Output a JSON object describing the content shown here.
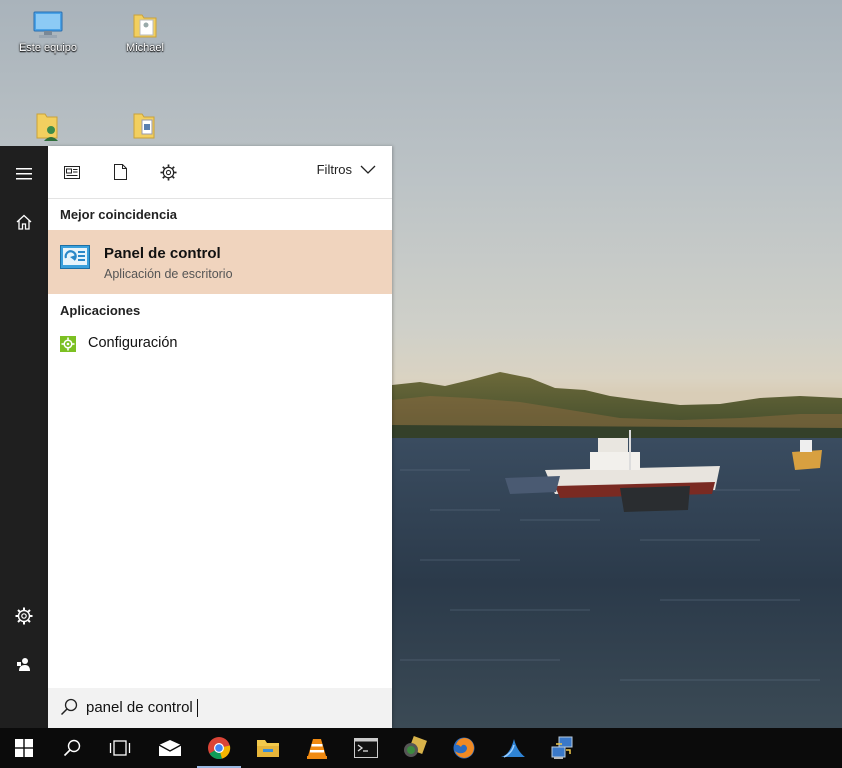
{
  "desktop": {
    "icons": [
      {
        "label": "Este equipo",
        "icon": "computer-icon"
      },
      {
        "label": "Michael",
        "icon": "user-folder-icon"
      },
      {
        "label": "",
        "icon": "user-folder-icon"
      },
      {
        "label": "",
        "icon": "document-folder-icon"
      }
    ]
  },
  "start_rail": {
    "items": [
      {
        "icon": "hamburger-menu-icon"
      },
      {
        "icon": "home-icon"
      },
      {
        "icon": "gear-icon"
      },
      {
        "icon": "user-icon"
      }
    ]
  },
  "search_panel": {
    "filters_label": "Filtros",
    "best_match_title": "Mejor coincidencia",
    "best_match": {
      "name": "Panel de control",
      "subtitle": "Aplicación de escritorio",
      "icon": "control-panel-icon",
      "highlight_color": "#f0d4be"
    },
    "apps_title": "Aplicaciones",
    "apps": [
      {
        "name": "Configuración",
        "icon": "settings-gear-icon"
      }
    ],
    "search_value": "panel de control"
  },
  "taskbar": {
    "items": [
      {
        "icon": "windows-start-icon"
      },
      {
        "icon": "search-icon"
      },
      {
        "icon": "task-view-icon"
      },
      {
        "icon": "mail-icon"
      },
      {
        "icon": "chrome-icon"
      },
      {
        "icon": "file-explorer-icon"
      },
      {
        "icon": "vlc-icon"
      },
      {
        "icon": "terminal-icon"
      },
      {
        "icon": "network-tool-icon"
      },
      {
        "icon": "firefox-icon"
      },
      {
        "icon": "wireshark-icon"
      },
      {
        "icon": "remote-desktop-icon"
      }
    ]
  },
  "colors": {
    "rail": "#1f1f1f",
    "taskbar": "#0b0b0b",
    "accent": "#f0d4be"
  }
}
